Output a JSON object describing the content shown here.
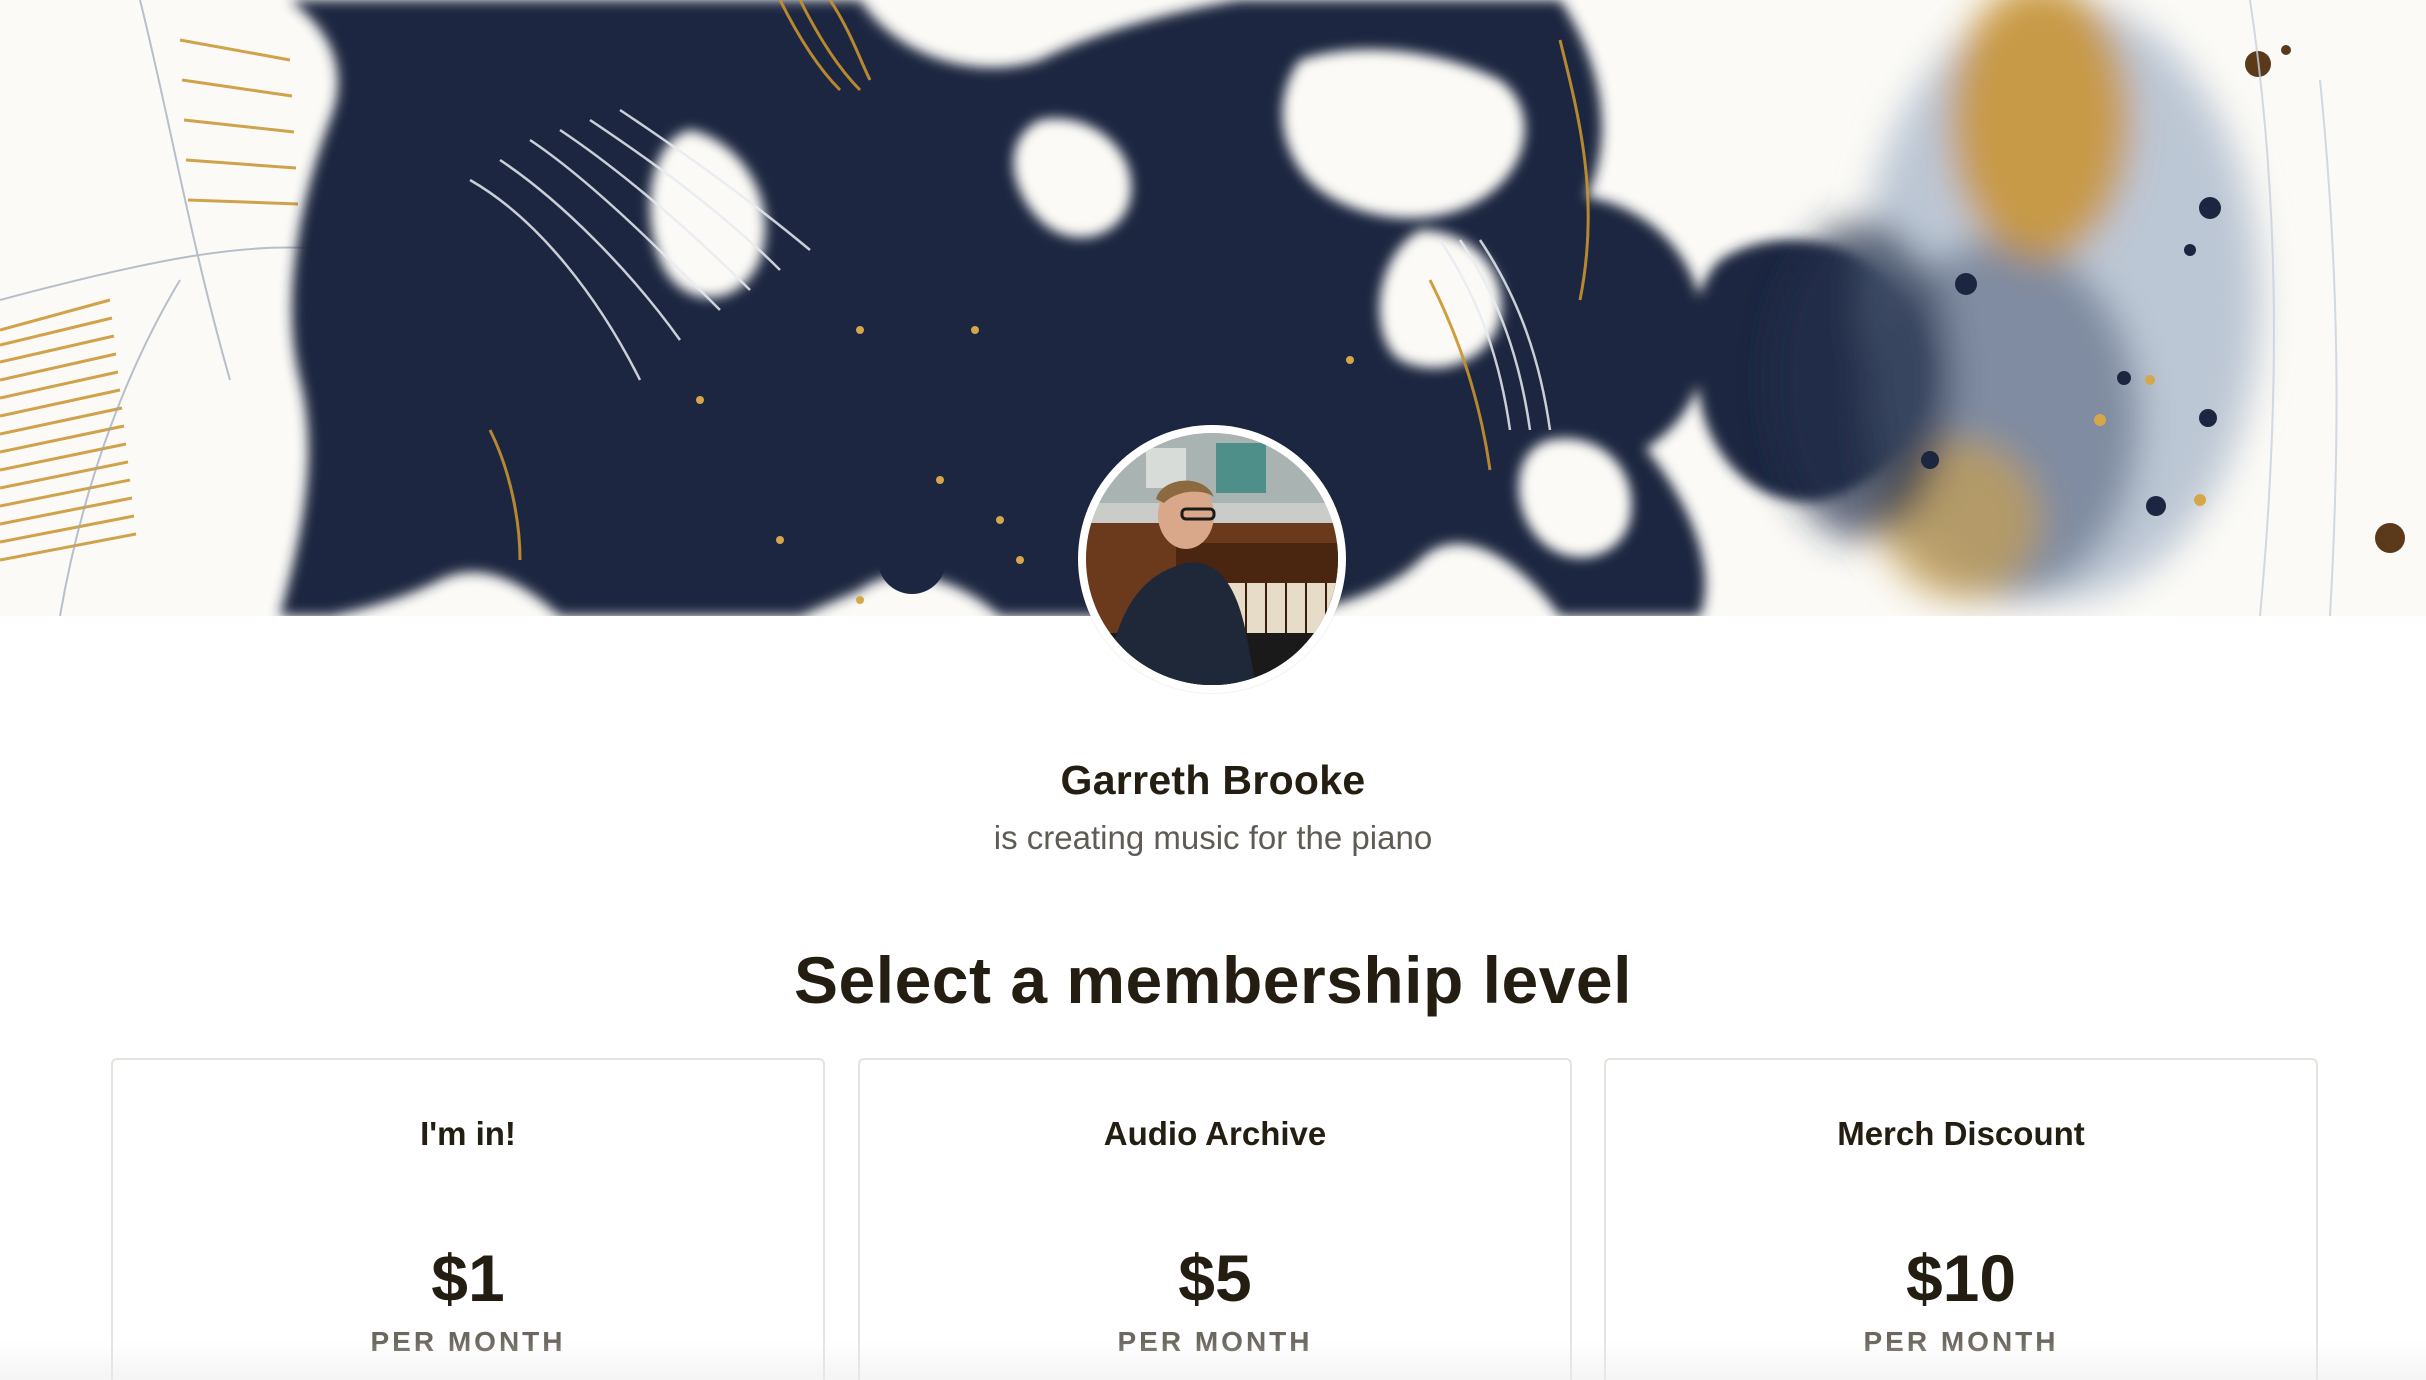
{
  "creator": {
    "name": "Garreth Brooke",
    "tagline": "is creating music for the piano"
  },
  "section": {
    "title": "Select a membership level"
  },
  "tiers": [
    {
      "name": "I'm in!",
      "price": "$1",
      "period": "PER MONTH"
    },
    {
      "name": "Audio Archive",
      "price": "$5",
      "period": "PER MONTH"
    },
    {
      "name": "Merch Discount",
      "price": "$10",
      "period": "PER MONTH"
    }
  ],
  "colors": {
    "ink_navy": "#1c2640",
    "ink_gold": "#c9932e",
    "text_dark": "#241e12",
    "text_muted": "#5f5b55",
    "card_border": "#e5e3dd"
  }
}
